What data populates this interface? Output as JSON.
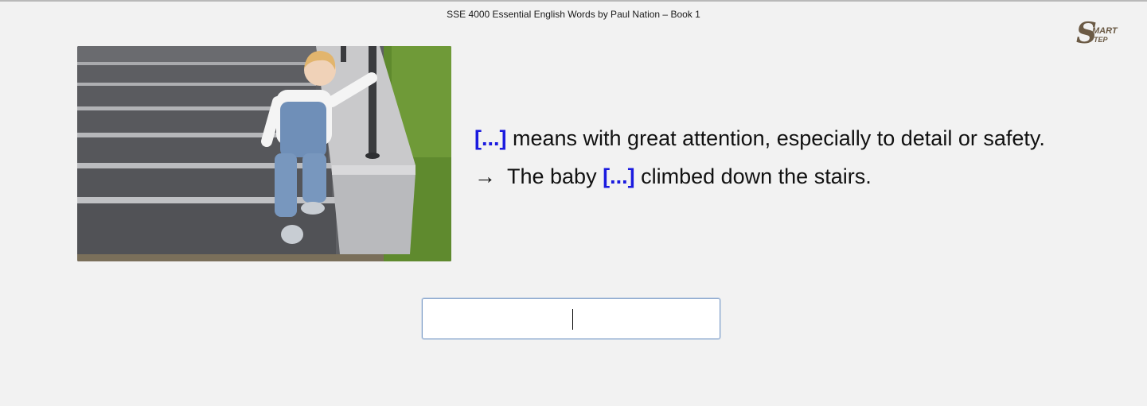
{
  "header": {
    "title": "SSE 4000 Essential English Words by Paul Nation – Book 1"
  },
  "logo": {
    "text_big": "S",
    "text_top": "MART",
    "text_bottom": "TEP",
    "color": "#6b5a45"
  },
  "card": {
    "blank_marker": "[...]",
    "definition_rest": " means with great attention, especially to detail or safety.",
    "arrow": "→",
    "example_before": "The baby ",
    "example_after": " climbed down the stairs."
  },
  "answer": {
    "value": "",
    "placeholder": ""
  },
  "colors": {
    "background": "#f2f2f2",
    "blank": "#1a1adf",
    "input_border": "#7f9ec8"
  }
}
